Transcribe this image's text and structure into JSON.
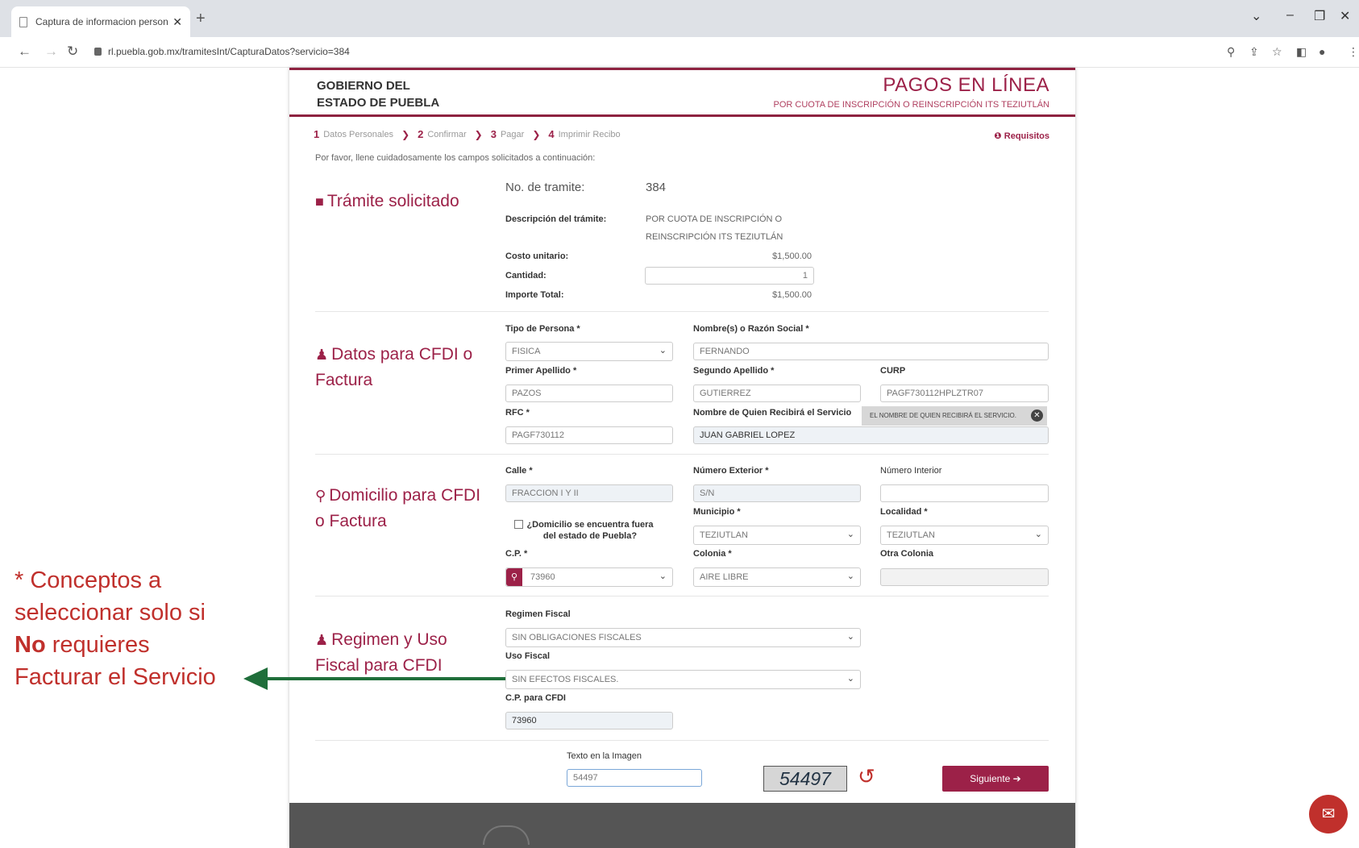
{
  "browser": {
    "tab_title": "Captura de informacion personal",
    "tab_close": "✕",
    "new_tab": "+",
    "url": "rl.puebla.gob.mx/tramitesInt/CapturaDatos?servicio=384"
  },
  "header": {
    "gov_line1": "GOBIERNO DEL",
    "gov_line2": "ESTADO DE PUEBLA",
    "title": "PAGOS EN LÍNEA",
    "subtitle": "POR CUOTA DE INSCRIPCIÓN O REINSCRIPCIÓN ITS TEZIUTLÁN"
  },
  "steps": [
    {
      "num": "1",
      "label": "Datos Personales"
    },
    {
      "num": "2",
      "label": "Confirmar"
    },
    {
      "num": "3",
      "label": "Pagar"
    },
    {
      "num": "4",
      "label": "Imprimir Recibo"
    }
  ],
  "requisitos": "Requisitos",
  "intro": "Por favor, llene cuidadosamente los campos solicitados a continuación:",
  "tramite": {
    "section_title": "Trámite solicitado",
    "no_label": "No. de tramite:",
    "no_value": "384",
    "desc_label": "Descripción del trámite:",
    "desc_line1": "POR CUOTA DE INSCRIPCIÓN O",
    "desc_line2": "REINSCRIPCIÓN ITS TEZIUTLÁN",
    "costo_label": "Costo unitario:",
    "costo_value": "$1,500.00",
    "cantidad_label": "Cantidad:",
    "cantidad_value": "1",
    "importe_label": "Importe Total:",
    "importe_value": "$1,500.00"
  },
  "cfdi": {
    "section_title": "Datos para CFDI o Factura",
    "tipo_label": "Tipo de Persona *",
    "tipo_value": "FISICA",
    "nombre_label": "Nombre(s) o Razón Social *",
    "nombre_value": "FERNANDO",
    "primer_label": "Primer Apellido *",
    "primer_value": "PAZOS",
    "segundo_label": "Segundo Apellido *",
    "segundo_value": "GUTIERREZ",
    "curp_label": "CURP",
    "curp_value": "PAGF730112HPLZTR07",
    "rfc_label": "RFC *",
    "rfc_value": "PAGF730112",
    "quien_label": "Nombre de Quien Recibirá el Servicio",
    "quien_tooltip": "EL NOMBRE DE QUIEN RECIBIRÁ EL SERVICIO.",
    "quien_value": "JUAN GABRIEL LOPEZ"
  },
  "domicilio": {
    "section_title": "Domicilio para CFDI o Factura",
    "calle_label": "Calle *",
    "calle_value": "FRACCION I Y II",
    "numext_label": "Número Exterior *",
    "numext_value": "S/N",
    "numint_label": "Número Interior",
    "numint_value": "",
    "fuera_label": "¿Domicilio se encuentra fuera del estado de Puebla?",
    "municipio_label": "Municipio *",
    "municipio_value": "TEZIUTLAN",
    "localidad_label": "Localidad *",
    "localidad_value": "TEZIUTLAN",
    "cp_label": "C.P. *",
    "cp_value": "73960",
    "colonia_label": "Colonia *",
    "colonia_value": "AIRE LIBRE",
    "otra_label": "Otra Colonia",
    "otra_value": ""
  },
  "regimen": {
    "section_title": "Regimen y Uso Fiscal para CFDI",
    "regimen_label": "Regimen Fiscal",
    "regimen_value": "SIN OBLIGACIONES FISCALES",
    "uso_label": "Uso Fiscal",
    "uso_value": "SIN EFECTOS FISCALES.",
    "cp_label": "C.P. para CFDI",
    "cp_value": "73960"
  },
  "captcha": {
    "label": "Texto en la Imagen",
    "input_value": "54497",
    "image_text": "54497"
  },
  "siguiente": "Siguiente ➔",
  "annotation": {
    "line1": "* Conceptos a",
    "line2": "seleccionar solo si",
    "bold": "No",
    "line3_rest": " requieres",
    "line4": "Facturar el Servicio"
  },
  "colors": {
    "brand": "#9c2148",
    "annotation": "#c0302c",
    "arrow": "#1f6e3a"
  }
}
